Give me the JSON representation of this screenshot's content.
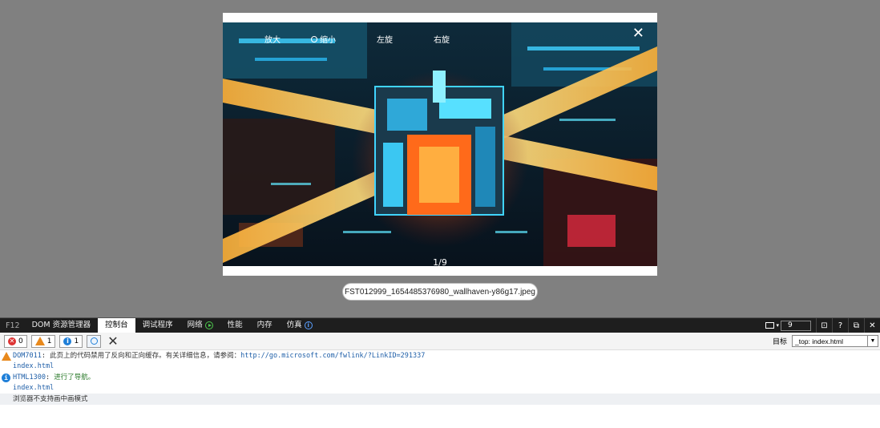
{
  "viewer": {
    "toolbar": {
      "zoom_in": "放大",
      "zoom_out": "缩小",
      "rotate_left": "左旋",
      "rotate_right": "右旋"
    },
    "close_glyph": "✕",
    "counter": "1/9",
    "filename": "FST012999_1654485376980_wallhaven-y86g17.jpeg"
  },
  "devtools": {
    "f12": "F12",
    "tabs": [
      {
        "label": "DOM 资源管理器"
      },
      {
        "label": "控制台",
        "active": true
      },
      {
        "label": "调试程序"
      },
      {
        "label": "网络"
      },
      {
        "label": "性能"
      },
      {
        "label": "内存"
      },
      {
        "label": "仿真"
      }
    ],
    "emulation_count": "9",
    "right_buttons": {
      "console": "⊡",
      "help": "?",
      "undock": "⧉",
      "close": "✕"
    },
    "filters": {
      "errors": "0",
      "warnings": "1",
      "info": "1"
    },
    "target_label": "目标",
    "target_value": "_top: index.html",
    "messages": [
      {
        "type": "warning",
        "code": "DOM7011",
        "text": "此页上的代码禁用了反向和正向缓存。有关详细信息，请参阅：",
        "link": "http://go.microsoft.com/fwlink/?LinkID=291337",
        "file": "index.html"
      },
      {
        "type": "info",
        "code": "HTML1300",
        "text": "进行了导航。",
        "file": "index.html"
      },
      {
        "type": "log",
        "text": "浏览器不支持画中画模式"
      }
    ]
  },
  "colors": {
    "overlay": "#808080",
    "devtools_bar": "#1e1e1e",
    "warning": "#e8891c",
    "info": "#1f7fd8",
    "error": "#d33333"
  }
}
